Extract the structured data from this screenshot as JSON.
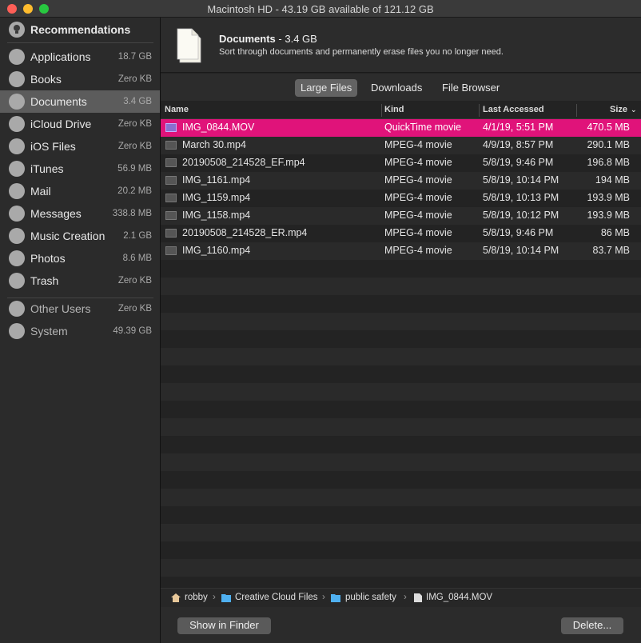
{
  "window": {
    "title": "Macintosh HD - 43.19 GB available of 121.12 GB"
  },
  "sidebar": {
    "recommendations": "Recommendations",
    "items": [
      {
        "label": "Applications",
        "size": "18.7 GB",
        "icon": "applications-icon"
      },
      {
        "label": "Books",
        "size": "Zero KB",
        "icon": "books-icon"
      },
      {
        "label": "Documents",
        "size": "3.4 GB",
        "icon": "documents-icon"
      },
      {
        "label": "iCloud Drive",
        "size": "Zero KB",
        "icon": "icloud-icon"
      },
      {
        "label": "iOS Files",
        "size": "Zero KB",
        "icon": "phone-icon"
      },
      {
        "label": "iTunes",
        "size": "56.9 MB",
        "icon": "music-note-icon"
      },
      {
        "label": "Mail",
        "size": "20.2 MB",
        "icon": "mail-icon"
      },
      {
        "label": "Messages",
        "size": "338.8 MB",
        "icon": "messages-icon"
      },
      {
        "label": "Music Creation",
        "size": "2.1 GB",
        "icon": "guitar-icon"
      },
      {
        "label": "Photos",
        "size": "8.6 MB",
        "icon": "photos-icon"
      },
      {
        "label": "Trash",
        "size": "Zero KB",
        "icon": "trash-icon"
      }
    ],
    "other": [
      {
        "label": "Other Users",
        "size": "Zero KB",
        "icon": "users-icon"
      },
      {
        "label": "System",
        "size": "49.39 GB",
        "icon": "gear-icon"
      }
    ]
  },
  "header": {
    "title": "Documents",
    "size": " - 3.4 GB",
    "description": "Sort through documents and permanently erase files you no longer need."
  },
  "tabs": [
    "Large Files",
    "Downloads",
    "File Browser"
  ],
  "columns": {
    "name": "Name",
    "kind": "Kind",
    "accessed": "Last Accessed",
    "size": "Size"
  },
  "files": [
    {
      "name": "IMG_0844.MOV",
      "kind": "QuickTime movie",
      "accessed": "4/1/19, 5:51 PM",
      "size": "470.5 MB"
    },
    {
      "name": "March 30.mp4",
      "kind": "MPEG-4 movie",
      "accessed": "4/9/19, 8:57 PM",
      "size": "290.1 MB"
    },
    {
      "name": "20190508_214528_EF.mp4",
      "kind": "MPEG-4 movie",
      "accessed": "5/8/19, 9:46 PM",
      "size": "196.8 MB"
    },
    {
      "name": "IMG_1161.mp4",
      "kind": "MPEG-4 movie",
      "accessed": "5/8/19, 10:14 PM",
      "size": "194 MB"
    },
    {
      "name": "IMG_1159.mp4",
      "kind": "MPEG-4 movie",
      "accessed": "5/8/19, 10:13 PM",
      "size": "193.9 MB"
    },
    {
      "name": "IMG_1158.mp4",
      "kind": "MPEG-4 movie",
      "accessed": "5/8/19, 10:12 PM",
      "size": "193.9 MB"
    },
    {
      "name": "20190508_214528_ER.mp4",
      "kind": "MPEG-4 movie",
      "accessed": "5/8/19, 9:46 PM",
      "size": "86 MB"
    },
    {
      "name": "IMG_1160.mp4",
      "kind": "MPEG-4 movie",
      "accessed": "5/8/19, 10:14 PM",
      "size": "83.7 MB"
    }
  ],
  "path": [
    "robby",
    "Creative Cloud Files",
    "public safety",
    "IMG_0844.MOV"
  ],
  "buttons": {
    "show_in_finder": "Show in Finder",
    "delete": "Delete..."
  },
  "colors": {
    "selection": "#e0137a",
    "sidebar_active": "#5c5c5c"
  }
}
